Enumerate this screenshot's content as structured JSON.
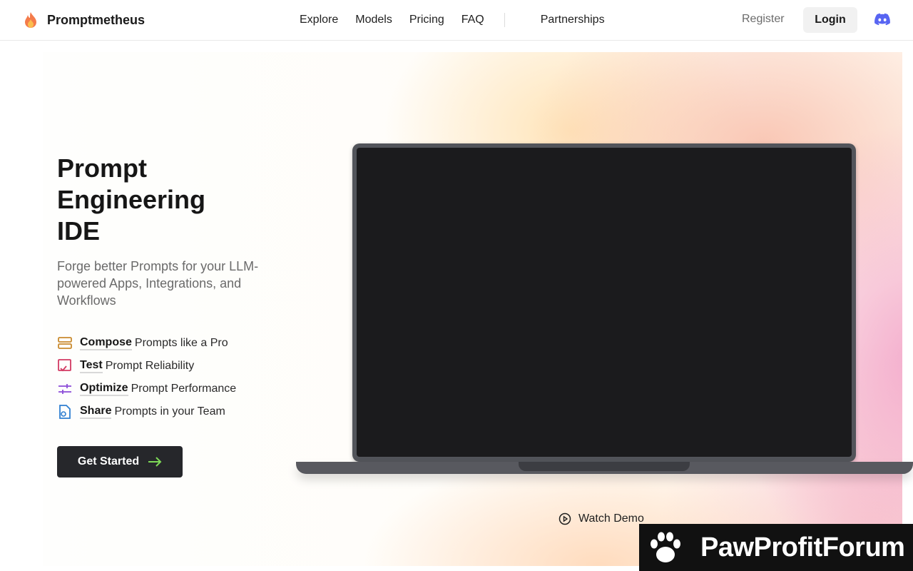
{
  "brand": {
    "name": "Promptmetheus"
  },
  "nav": {
    "items": [
      "Explore",
      "Models",
      "Pricing",
      "FAQ"
    ],
    "partnerships": "Partnerships"
  },
  "auth": {
    "register": "Register",
    "login": "Login"
  },
  "hero": {
    "title_lines": [
      "Prompt",
      "Engineering",
      "IDE"
    ],
    "subtitle": "Forge better Prompts for your LLM-powered Apps, Integrations, and Workflows",
    "features": [
      {
        "bold": "Compose",
        "rest": "Prompts like a Pro",
        "icon": "stack-icon",
        "color": "#c98a2e"
      },
      {
        "bold": "Test",
        "rest": "Prompt Reliability",
        "icon": "test-check-icon",
        "color": "#d23a63"
      },
      {
        "bold": "Optimize",
        "rest": "Prompt Performance",
        "icon": "sliders-icon",
        "color": "#8b4bd8"
      },
      {
        "bold": "Share",
        "rest": "Prompts in your Team",
        "icon": "share-doc-icon",
        "color": "#2f7fd1"
      }
    ],
    "cta": "Get Started",
    "watch_demo": "Watch Demo"
  },
  "watermark": {
    "text": "PawProfitForum"
  },
  "colors": {
    "accent_arrow": "#7ed957",
    "cta_bg": "#26272b",
    "discord": "#5865f2"
  }
}
